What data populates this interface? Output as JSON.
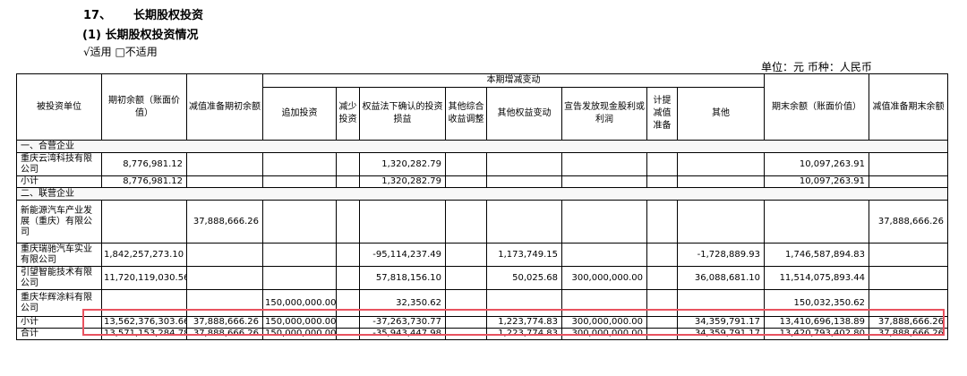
{
  "section": {
    "number": "17、",
    "title": "长期股权投资",
    "subtitle": "(1) 长期股权投资情况",
    "applicability": "√适用 □不适用",
    "unit": "单位：元 币种：人民币"
  },
  "table": {
    "headers": {
      "investee": "被投资单位",
      "opening_balance": "期初余额（账面价值）",
      "impairment_opening": "减值准备期初余额",
      "changes_group": "本期增减变动",
      "additional_investment": "追加投资",
      "reduced_investment": "减少投资",
      "equity_method_income": "权益法下确认的投资损益",
      "oci_adjustment": "其他综合收益调整",
      "other_equity_changes": "其他权益变动",
      "cash_dividends": "宣告发放现金股利或利润",
      "impairment_provision": "计提减值准备",
      "other": "其他",
      "closing_balance": "期末余额（账面价值）",
      "impairment_closing": "减值准备期末余额"
    },
    "rows": [
      {
        "type": "category",
        "label": "一、合营企业"
      },
      {
        "type": "data",
        "name": "重庆云湾科技有限公司",
        "cells": [
          "8,776,981.12",
          "",
          "",
          "",
          "1,320,282.79",
          "",
          "",
          "",
          "",
          "",
          "10,097,263.91",
          ""
        ]
      },
      {
        "type": "data",
        "name": "小计",
        "cells": [
          "8,776,981.12",
          "",
          "",
          "",
          "1,320,282.79",
          "",
          "",
          "",
          "",
          "",
          "10,097,263.91",
          ""
        ]
      },
      {
        "type": "category",
        "label": "二、联营企业"
      },
      {
        "type": "data",
        "name": "新能源汽车产业发展（重庆）有限公司",
        "cells": [
          "",
          "37,888,666.26",
          "",
          "",
          "",
          "",
          "",
          "",
          "",
          "",
          "",
          "37,888,666.26"
        ]
      },
      {
        "type": "data",
        "name": "重庆瑞驰汽车实业有限公司",
        "cells": [
          "1,842,257,273.10",
          "",
          "",
          "",
          "-95,114,237.49",
          "",
          "1,173,749.15",
          "",
          "",
          "-1,728,889.93",
          "1,746,587,894.83",
          ""
        ]
      },
      {
        "type": "data",
        "name": "引望智能技术有限公司",
        "cells": [
          "11,720,119,030.56",
          "",
          "",
          "",
          "57,818,156.10",
          "",
          "50,025.68",
          "300,000,000.00",
          "",
          "36,088,681.10",
          "11,514,075,893.44",
          ""
        ]
      },
      {
        "type": "data",
        "name": "重庆华辉涂料有限公司",
        "cells": [
          "",
          "",
          "150,000,000.00",
          "",
          "32,350.62",
          "",
          "",
          "",
          "",
          "",
          "150,032,350.62",
          ""
        ]
      },
      {
        "type": "data",
        "name": "小计",
        "cells": [
          "13,562,376,303.66",
          "37,888,666.26",
          "150,000,000.00",
          "",
          "-37,263,730.77",
          "",
          "1,223,774.83",
          "300,000,000.00",
          "",
          "34,359,791.17",
          "13,410,696,138.89",
          "37,888,666.26"
        ]
      },
      {
        "type": "data",
        "name": "合计",
        "cells": [
          "13,571,153,284.78",
          "37,888,666.26",
          "150,000,000.00",
          "",
          "-35,943,447.98",
          "",
          "1,223,774.83",
          "300,000,000.00",
          "",
          "34,359,791.17",
          "13,420,793,402.80",
          "37,888,666.26"
        ]
      }
    ]
  },
  "colors": {
    "highlight_border": "#e8525f",
    "grid": "#000000"
  }
}
